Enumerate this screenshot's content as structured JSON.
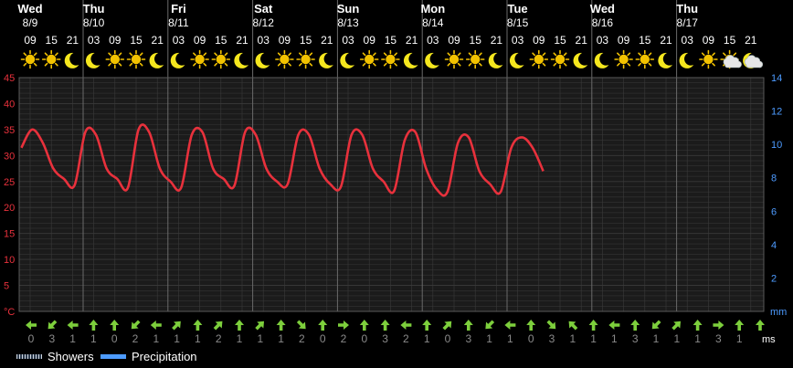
{
  "chart_data": {
    "type": "line",
    "days": [
      {
        "day": "Wed",
        "date": "8/9"
      },
      {
        "day": "Thu",
        "date": "8/10"
      },
      {
        "day": "Fri",
        "date": "8/11"
      },
      {
        "day": "Sat",
        "date": "8/12"
      },
      {
        "day": "Sun",
        "date": "8/13"
      },
      {
        "day": "Mon",
        "date": "8/14"
      },
      {
        "day": "Tue",
        "date": "8/15"
      },
      {
        "day": "Wed",
        "date": "8/16"
      },
      {
        "day": "Thu",
        "date": "8/17"
      }
    ],
    "hours": [
      "09",
      "15",
      "21",
      "03",
      "09",
      "15",
      "21",
      "03",
      "09",
      "15",
      "21",
      "03",
      "09",
      "15",
      "21",
      "03",
      "09",
      "15",
      "21",
      "03",
      "09",
      "15",
      "21",
      "03",
      "09",
      "15",
      "21",
      "03",
      "09",
      "15",
      "21",
      "03",
      "09",
      "15",
      "21"
    ],
    "weather_icons": [
      "sun",
      "sun",
      "moon",
      "moon",
      "sun",
      "sun",
      "moon",
      "moon",
      "sun",
      "sun",
      "moon",
      "moon",
      "sun",
      "sun",
      "moon",
      "moon",
      "sun",
      "sun",
      "moon",
      "moon",
      "sun",
      "sun",
      "moon",
      "moon",
      "sun",
      "sun",
      "moon",
      "moon",
      "sun",
      "sun",
      "moon",
      "moon",
      "sun",
      "partly-cloudy-day",
      "partly-cloudy-night"
    ],
    "series": [
      {
        "values": [
          31.5,
          35,
          32.5,
          27.5,
          25.5,
          24.3,
          34.5,
          34,
          27.5,
          25.5,
          23.8,
          35,
          34.5,
          27.5,
          25,
          23.8,
          34,
          34.5,
          27.5,
          25.5,
          24.2,
          34.5,
          34,
          27.5,
          25,
          24.5,
          34,
          34,
          27.5,
          24.5,
          24,
          34,
          34,
          27.5,
          25,
          23.2,
          33,
          34.5,
          27.5,
          23.5,
          23,
          32.5,
          33.5,
          27,
          24.5,
          23,
          31.5,
          33.5,
          31.5,
          27
        ]
      }
    ],
    "wind_directions": [
      "W",
      "SW",
      "W",
      "N",
      "N",
      "SW",
      "W",
      "NE",
      "N",
      "NE",
      "N",
      "NE",
      "N",
      "SE",
      "N",
      "E",
      "N",
      "N",
      "W",
      "N",
      "NE",
      "N",
      "SW",
      "W",
      "N",
      "SE",
      "NW",
      "N",
      "W",
      "N",
      "SW",
      "NE",
      "N",
      "E",
      "N",
      "N"
    ],
    "wind_speeds": [
      "0",
      "3",
      "1",
      "1",
      "0",
      "2",
      "1",
      "1",
      "1",
      "2",
      "1",
      "1",
      "1",
      "2",
      "0",
      "2",
      "0",
      "3",
      "2",
      "1",
      "0",
      "3",
      "1",
      "1",
      "0",
      "3",
      "1",
      "1",
      "1",
      "3",
      "1",
      "1",
      "1",
      "3",
      "1"
    ],
    "y_left": {
      "unit": "°C",
      "ticks": [
        "45",
        "40",
        "35",
        "30",
        "25",
        "20",
        "15",
        "10",
        "5"
      ],
      "ylim": [
        0,
        45
      ]
    },
    "y_right": {
      "unit": "mm",
      "ticks": [
        "14",
        "12",
        "10",
        "8",
        "6",
        "4",
        "2"
      ],
      "ylim": [
        0,
        14
      ]
    },
    "wind_unit": "ms",
    "legend": {
      "showers": "Showers",
      "precipitation": "Precipitation"
    },
    "colors": {
      "line": "#e8313c",
      "left_axis": "#e8313c",
      "right_axis": "#4d9bff",
      "wind": "#7dcf3c",
      "grid": "#3a3a3a",
      "day_divider": "#6a6a6a",
      "sun": "#f2c200",
      "moon": "#f5e71e"
    },
    "grid": true
  }
}
